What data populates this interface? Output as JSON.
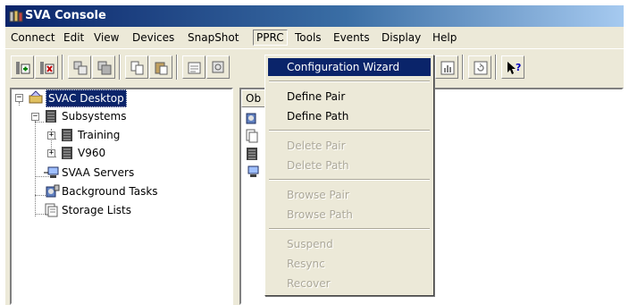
{
  "window": {
    "title": "SVA Console"
  },
  "menubar": {
    "items": [
      "Connect",
      "Edit",
      "View",
      "Devices",
      "SnapShot",
      "PPRC",
      "Tools",
      "Events",
      "Display",
      "Help"
    ],
    "active": "PPRC"
  },
  "toolbar": {
    "buttons": [
      "add-icon",
      "remove-icon",
      "copy-config-icon",
      "paste-config-icon",
      "copy-icon",
      "paste-icon",
      "properties-icon",
      "settings-icon",
      "report-icon",
      "refresh-icon",
      "help-icon"
    ]
  },
  "tree": {
    "root": "SVAC Desktop",
    "subsystems": "Subsystems",
    "training": "Training",
    "v960": "V960",
    "svaa_servers": "SVAA Servers",
    "background_tasks": "Background Tasks",
    "storage_lists": "Storage Lists"
  },
  "right_pane": {
    "column_header": "Ob"
  },
  "pprc_menu": {
    "configuration_wizard": "Configuration Wizard",
    "define_pair": "Define Pair",
    "define_path": "Define Path",
    "delete_pair": "Delete Pair",
    "delete_path": "Delete Path",
    "browse_pair": "Browse Pair",
    "browse_path": "Browse Path",
    "suspend": "Suspend",
    "resync": "Resync",
    "recover": "Recover"
  },
  "colors": {
    "title_start": "#0a246a",
    "title_end": "#a6caf0",
    "highlight": "#0a246a",
    "disabled_text": "#aca899",
    "chrome": "#ece9d8"
  }
}
